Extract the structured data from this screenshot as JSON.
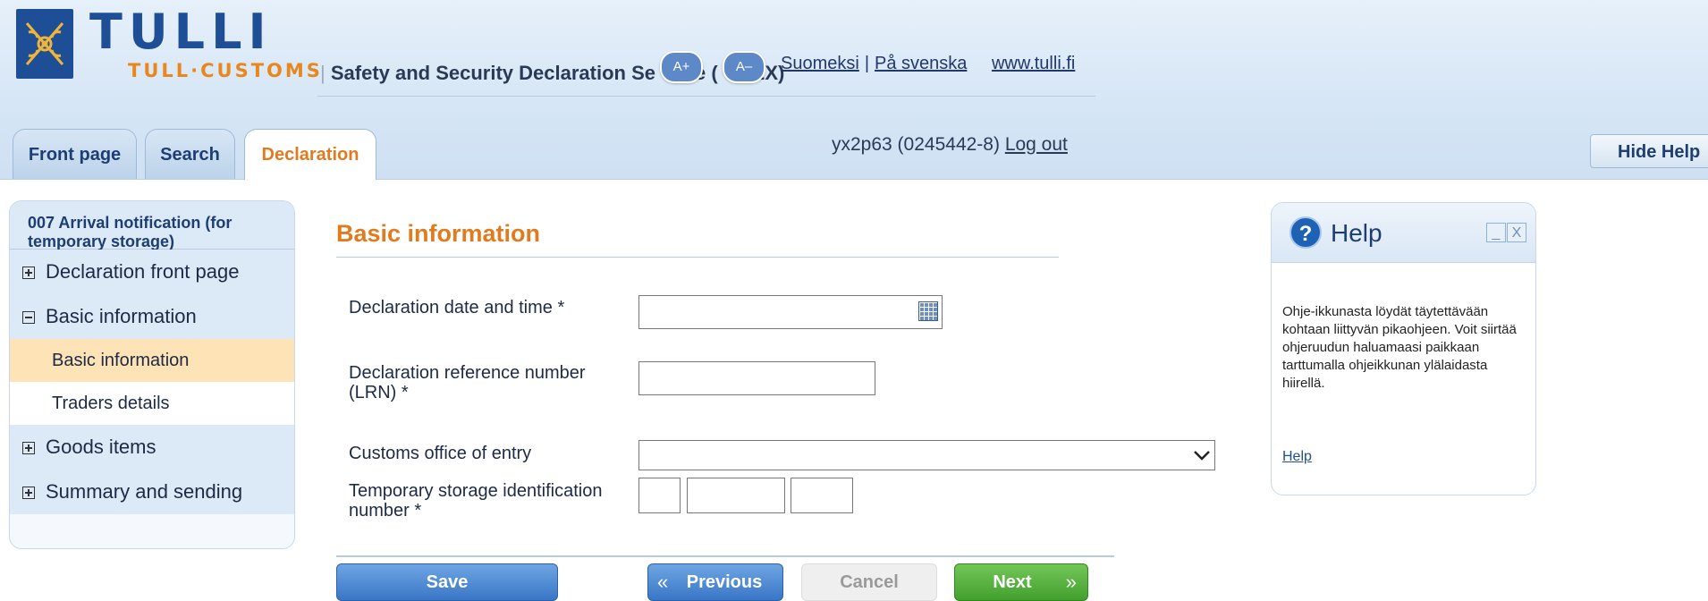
{
  "header": {
    "brand": "TULLI",
    "brand_sub": "TULL·CUSTOMS",
    "service_title": "Safety and Security Declaration Se",
    "service_title_tail": "e (",
    "service_title_end": "EX)",
    "font_increase": "A+",
    "font_decrease": "A–",
    "lang_fi": "Suomeksi",
    "lang_sv": "På svenska",
    "site_link": "www.tulli.fi",
    "separator": "|"
  },
  "tabs": [
    {
      "label": "Front page",
      "active": false
    },
    {
      "label": "Search",
      "active": false
    },
    {
      "label": "Declaration",
      "active": true
    }
  ],
  "user": {
    "id_text": "yx2p63 (0245442-8)",
    "logout": "Log out"
  },
  "hide_help": "Hide Help",
  "leftnav": {
    "heading": "007 Arrival notification (for temporary storage)",
    "items": [
      {
        "label": "Declaration front page",
        "state": "collapsed"
      },
      {
        "label": "Basic information",
        "state": "expanded"
      },
      {
        "label": "Basic information",
        "sub": true,
        "selected": true
      },
      {
        "label": "Traders details",
        "sub": true,
        "selected": false
      },
      {
        "label": "Goods items",
        "state": "collapsed"
      },
      {
        "label": "Summary and sending",
        "state": "collapsed"
      }
    ]
  },
  "form": {
    "title": "Basic information",
    "fields": {
      "declaration_date": {
        "label": "Declaration date and time *",
        "value": ""
      },
      "lrn": {
        "label_line1": "Declaration reference number",
        "label_line2": "(LRN) *",
        "value": ""
      },
      "office_of_entry": {
        "label": "Customs office of entry",
        "value": ""
      },
      "temp_storage": {
        "label_line1": "Temporary storage identification",
        "label_line2": "number *",
        "values": [
          "",
          "",
          ""
        ]
      }
    },
    "buttons": {
      "save": "Save",
      "previous": "Previous",
      "previous_arrow": "«",
      "cancel": "Cancel",
      "next": "Next",
      "next_arrow": "»"
    }
  },
  "help": {
    "title": "Help",
    "question_mark": "?",
    "minimize": "_",
    "close": "X",
    "text": "Ohje-ikkunasta löydät täytettävään kohtaan liittyvän pikaohjeen. Voit siirtää ohjeruudun haluamaasi paikkaan tarttumalla ohjeikkunan ylälaidasta hiirellä.",
    "link": "Help"
  },
  "colors": {
    "brand_blue": "#1d4e96",
    "accent_orange": "#e07b20",
    "selected_bg": "#fde3b5",
    "next_green": "#43a02e",
    "save_blue": "#3a76c7"
  }
}
